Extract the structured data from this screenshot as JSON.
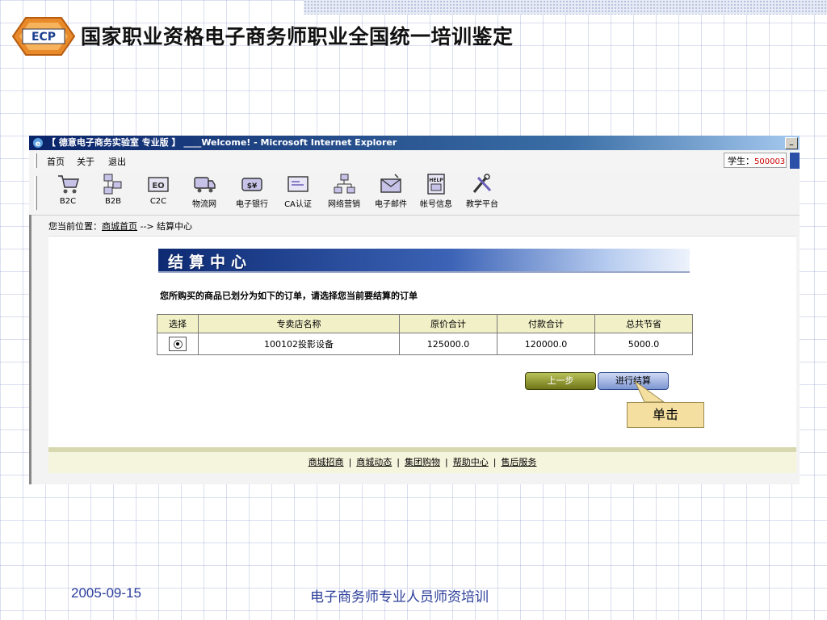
{
  "slide": {
    "title": "国家职业资格电子商务师职业全国统一培训鉴定",
    "logo_text": "ECP",
    "footer_date": "2005-09-15",
    "footer_title": "电子商务师专业人员师资培训",
    "callout": "单击"
  },
  "browser": {
    "window_title": "【 德意电子商务实验室 专业版 】 ____Welcome! - Microsoft Internet Explorer",
    "menu": [
      "首页",
      "关于",
      "退出"
    ],
    "student_label": "学生：",
    "student_id": "500003",
    "toolbar": [
      {
        "label": "B2C",
        "icon": "cart-icon"
      },
      {
        "label": "B2B",
        "icon": "network-boxes-icon"
      },
      {
        "label": "C2C",
        "icon": "c2c-icon"
      },
      {
        "label": "物流网",
        "icon": "truck-icon"
      },
      {
        "label": "电子银行",
        "icon": "money-icon"
      },
      {
        "label": "CA认证",
        "icon": "certificate-icon"
      },
      {
        "label": "网络营销",
        "icon": "org-chart-icon"
      },
      {
        "label": "电子邮件",
        "icon": "mail-icon"
      },
      {
        "label": "帐号信息",
        "icon": "help-book-icon"
      },
      {
        "label": "教学平台",
        "icon": "tools-icon"
      }
    ]
  },
  "page": {
    "breadcrumb_prefix": "您当前位置：",
    "breadcrumb_link": "商城首页",
    "breadcrumb_rest": " --> 结算中心",
    "banner": "结算中心",
    "instruction": "您所购买的商品已划分为如下的订单，请选择您当前要结算的订单",
    "table": {
      "headers": [
        "选择",
        "专卖店名称",
        "原价合计",
        "付款合计",
        "总共节省"
      ],
      "rows": [
        {
          "store": "100102投影设备",
          "original": "125000.0",
          "paid": "120000.0",
          "saved": "5000.0",
          "selected": true
        }
      ]
    },
    "btn_prev": "上一步",
    "btn_next": "进行结算",
    "footer_links": [
      "商城招商",
      "商城动态",
      "集团购物",
      "帮助中心",
      "售后服务"
    ],
    "footer_sep": "|"
  }
}
